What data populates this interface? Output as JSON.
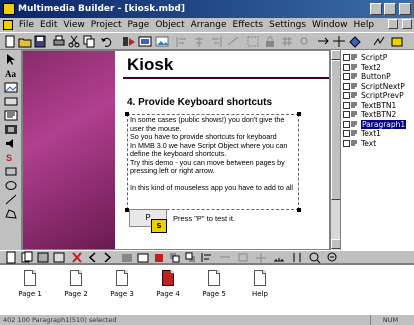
{
  "window": {
    "title": "Multimedia Builder - [kiosk.mbd]"
  },
  "menu": [
    "File",
    "Edit",
    "View",
    "Project",
    "Page",
    "Object",
    "Arrange",
    "Effects",
    "Settings",
    "Window",
    "Help"
  ],
  "canvas": {
    "heading": "Kiosk",
    "section_title": "4. Provide Keyboard shortcuts",
    "paragraphs": [
      "In some cases (public shows!) you don't give the user the mouse.\nSo you have to provide shortcuts for keyboard\nIn MMB 3.0 we have Script Object where you can define the keyboard shortcuts.\nTry this demo - you can move between pages by pressing left or right arrow.",
      "In this kind of mouseless app you have to add to all"
    ],
    "button_label": "P",
    "button_hint": "S",
    "button_caption": "Press \"P\" to test it."
  },
  "objects": [
    {
      "label": "ScriptP"
    },
    {
      "label": "Text2"
    },
    {
      "label": "ButtonP"
    },
    {
      "label": "ScriptNextP"
    },
    {
      "label": "ScriptPrevP"
    },
    {
      "label": "TextBTN1"
    },
    {
      "label": "TextBTN2"
    },
    {
      "label": "Paragraph1",
      "selected": true
    },
    {
      "label": "Text1"
    },
    {
      "label": "Text"
    }
  ],
  "pages": [
    {
      "label": "Page 1"
    },
    {
      "label": "Page 2"
    },
    {
      "label": "Page 3"
    },
    {
      "label": "Page 4",
      "active": true
    },
    {
      "label": "Page 5"
    },
    {
      "label": "Help"
    }
  ],
  "status": {
    "left": "402 100  Paragraph1(510) selected",
    "right": "NUM"
  },
  "colors": {
    "title_bar": "#0a246a",
    "accent_purple": "#b04090",
    "selection": "#000080",
    "active_page": "#c02020"
  }
}
